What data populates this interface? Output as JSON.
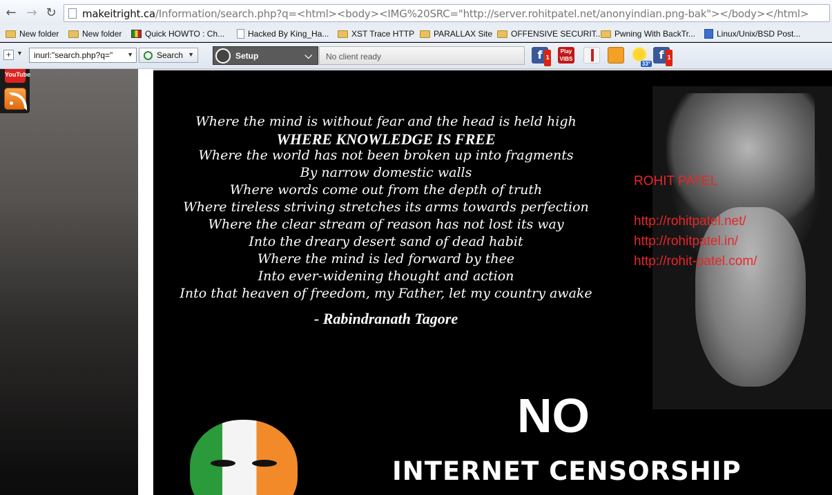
{
  "browser": {
    "url_host": "makeitright.ca",
    "url_path": "/Information/search.php?q=<html><body><IMG%20SRC=\"http://server.rohitpatel.net/anonyindian.png-bak\"></body></html>",
    "back_icon": "back-arrow-icon",
    "forward_icon": "forward-arrow-icon",
    "reload_icon": "reload-icon"
  },
  "bookmarks": [
    {
      "label": "New folder",
      "icon": "folder-icon"
    },
    {
      "label": "New folder",
      "icon": "folder-icon"
    },
    {
      "label": "Quick HOWTO : Ch...",
      "icon": "flag-icon"
    },
    {
      "label": "Hacked By King_Ha...",
      "icon": "page-icon"
    },
    {
      "label": "XST Trace HTTP",
      "icon": "folder-icon"
    },
    {
      "label": "PARALLAX Site",
      "icon": "folder-icon"
    },
    {
      "label": "OFFENSIVE SECURIT...",
      "icon": "folder-icon"
    },
    {
      "label": "Pwning With BackTr...",
      "icon": "folder-icon"
    },
    {
      "label": "Linux/Unix/BSD Post...",
      "icon": "doc-icon"
    }
  ],
  "toolbar": {
    "search_value": "inurl:\"search.php?q=\"",
    "search_button": "Search",
    "setup_label": "Setup",
    "client_status": "No client ready",
    "facebook_badge_1": "1",
    "play_label": "Play VIBS",
    "weather_temp": "33°",
    "facebook_badge_2": "1"
  },
  "sidebar": {
    "youtube_label": "YouTube",
    "rss_icon": "rss-icon"
  },
  "content": {
    "poem_lines": [
      "Where the mind is without fear and the head is held high",
      "WHERE KNOWLEDGE IS FREE",
      "Where the world has not been broken up into fragments",
      "By narrow domestic walls",
      "Where words come out from the depth of truth",
      "Where tireless striving stretches its arms towards perfection",
      "Where the clear stream of reason has not lost its way",
      "Into the dreary desert sand of dead habit",
      "Where the mind is led forward by thee",
      "Into ever-widening thought and action",
      "Into that heaven of freedom, my Father, let my country awake"
    ],
    "author": "- Rabindranath Tagore",
    "promo_name": "ROHIT PATEL",
    "promo_links": [
      "http://rohitpatel.net/",
      "http://rohitpatel.in/",
      "http://rohit-patel.com/"
    ],
    "slogan_big": "NO",
    "slogan_small": "INTERNET CENSORSHIP"
  },
  "colors": {
    "promo_red": "#e8262a",
    "background": "#000000"
  }
}
